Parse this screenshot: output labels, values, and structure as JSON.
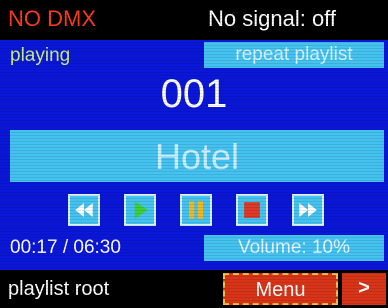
{
  "header": {
    "dmx_status": "NO DMX",
    "signal_status": "No signal: off"
  },
  "status": {
    "state": "playing",
    "repeat_mode": "repeat playlist"
  },
  "track": {
    "number": "001",
    "title": "Hotel"
  },
  "transport": {
    "buttons": [
      {
        "icon": "rewind-icon"
      },
      {
        "icon": "play-icon"
      },
      {
        "icon": "pause-icon"
      },
      {
        "icon": "stop-icon"
      },
      {
        "icon": "fast-forward-icon"
      }
    ]
  },
  "time": {
    "readout": "00:17 / 06:30"
  },
  "volume": {
    "label": "Volume: 10%"
  },
  "footer": {
    "context": "playlist root",
    "menu_label": "Menu",
    "next_label": ">"
  },
  "colors": {
    "background": "#0a16d8",
    "panel": "#45c3f0",
    "alert": "#ff3b1e",
    "menu": "#d83418",
    "play": "#3fcf3a",
    "pause": "#f2b81e",
    "stop": "#dd3a2a"
  }
}
